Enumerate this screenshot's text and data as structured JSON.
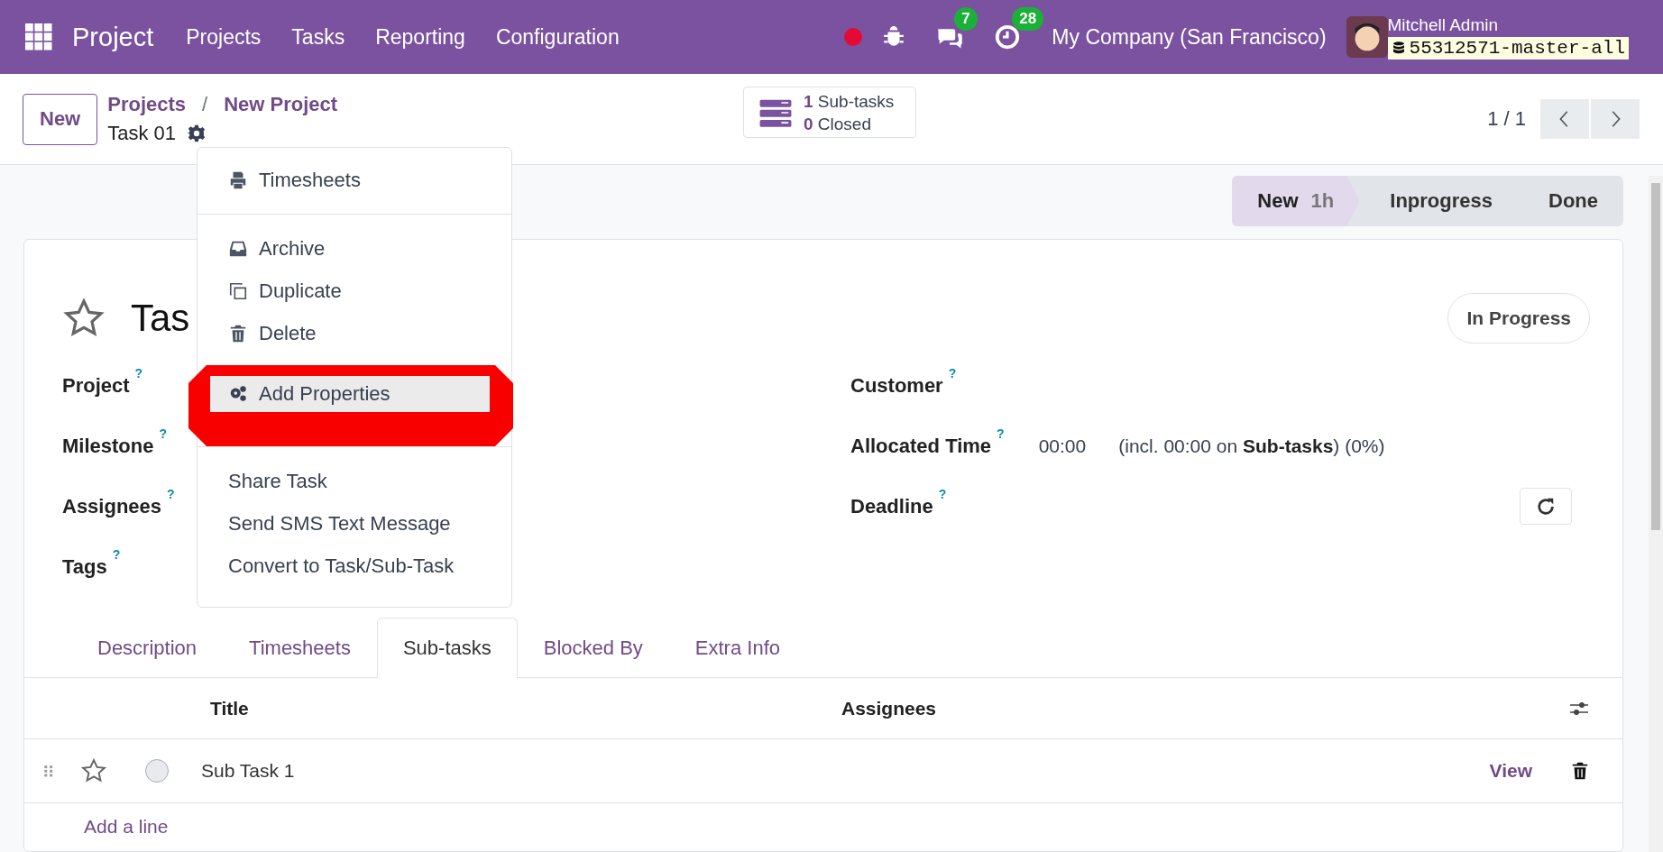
{
  "navbar": {
    "app": "Project",
    "menu": [
      "Projects",
      "Tasks",
      "Reporting",
      "Configuration"
    ],
    "chat_count": "7",
    "activity_count": "28",
    "company": "My Company (San Francisco)",
    "user": "Mitchell Admin",
    "database": "55312571-master-all"
  },
  "control_panel": {
    "new_button": "New",
    "breadcrumbs": [
      "Projects",
      "New Project"
    ],
    "breadcrumb_separator": "/",
    "record": "Task 01",
    "smart_button": {
      "lines": [
        {
          "count": "1",
          "label": "Sub-tasks"
        },
        {
          "count": "0",
          "label": "Closed"
        }
      ]
    },
    "pager": "1 / 1"
  },
  "action_menu": {
    "groups": [
      [
        {
          "label": "Timesheets",
          "selected": false
        }
      ],
      [
        {
          "label": "Archive",
          "selected": false
        },
        {
          "label": "Duplicate",
          "selected": false
        },
        {
          "label": "Delete",
          "selected": false
        },
        {
          "label": "Add Properties",
          "selected": true
        }
      ],
      [
        {
          "label": "Share Task",
          "selected": false
        },
        {
          "label": "Send SMS Text Message",
          "selected": false
        },
        {
          "label": "Convert to Task/Sub-Task",
          "selected": false
        }
      ]
    ]
  },
  "status_bar": {
    "stages": [
      {
        "label": "New",
        "duration": "1h",
        "selected": true
      },
      {
        "label": "Inprogress",
        "selected": false
      },
      {
        "label": "Done",
        "selected": false
      }
    ]
  },
  "form": {
    "title": "Tas",
    "starred": false,
    "state_button": "In Progress",
    "left_fields": [
      {
        "label": "Project",
        "help": "?"
      },
      {
        "label": "Milestone",
        "help": "?"
      },
      {
        "label": "Assignees",
        "help": "?"
      },
      {
        "label": "Tags",
        "help": "?"
      }
    ],
    "right_fields": [
      {
        "label": "Customer",
        "help": "?"
      },
      {
        "label": "Allocated Time",
        "help": "?",
        "value": "00:00",
        "note": "(incl. 00:00 on **Sub-tasks**) (0%)"
      },
      {
        "label": "Deadline",
        "help": "?",
        "reset": true
      }
    ]
  },
  "tabs": [
    {
      "label": "Description",
      "selected": false
    },
    {
      "label": "Timesheets",
      "selected": false
    },
    {
      "label": "Sub-tasks",
      "selected": true
    },
    {
      "label": "Blocked By",
      "selected": false
    },
    {
      "label": "Extra Info",
      "selected": false
    }
  ],
  "subtasks": {
    "columns": [
      "Title",
      "Assignees"
    ],
    "rows": [
      {
        "title": "Sub Task 1",
        "starred": false,
        "done": false,
        "action": "View"
      }
    ],
    "add_line": "Add a line"
  }
}
